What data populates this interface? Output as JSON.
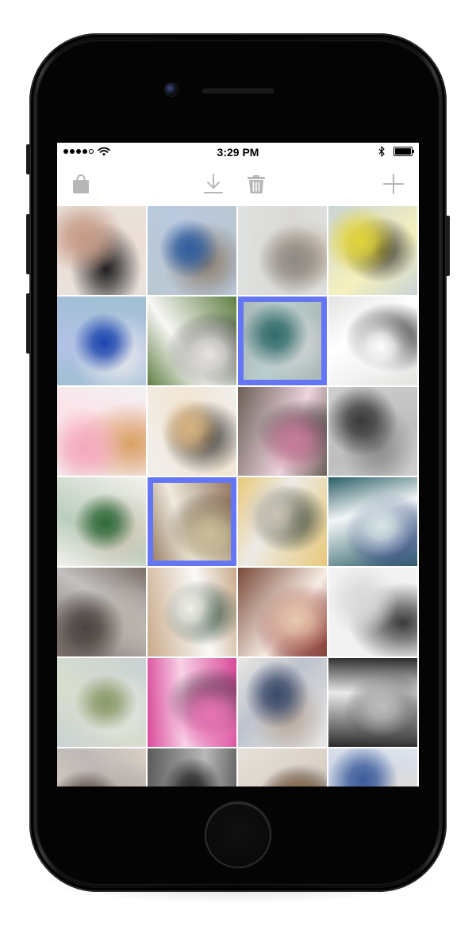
{
  "status_bar": {
    "carrier_signal": "●●●●○",
    "time": "3:29 PM",
    "bluetooth_icon": "bluetooth-icon",
    "battery_icon": "battery-icon",
    "wifi_icon": "wifi-icon"
  },
  "toolbar": {
    "left_icon": "shopping-bag-icon",
    "download_icon": "download-icon",
    "trash_icon": "trash-icon",
    "add_icon": "plus-icon",
    "icon_color": "#b7b7b7"
  },
  "accent_color": "#6476f5",
  "photos": [
    {
      "name": "photo-hands-lace",
      "colors": [
        "#e9e2db",
        "#c59a85",
        "#1d1d1d"
      ],
      "selected": false
    },
    {
      "name": "photo-three-guys-street",
      "colors": [
        "#b9c7d0",
        "#2f5e9e",
        "#8c7d6c"
      ],
      "selected": false
    },
    {
      "name": "photo-woman-curly-hair",
      "colors": [
        "#dfe2e0",
        "#8e8a83",
        "#c9b7a6"
      ],
      "selected": false
    },
    {
      "name": "photo-woman-yellow-flowers",
      "colors": [
        "#c9d4d6",
        "#e3d43a",
        "#2d2d2d"
      ],
      "selected": false
    },
    {
      "name": "photo-woman-blue-coat",
      "colors": [
        "#9fc0d3",
        "#1a45b0",
        "#e8e9ea"
      ],
      "selected": false
    },
    {
      "name": "photo-woman-striped-shirt",
      "colors": [
        "#5f7f43",
        "#e8e6e2",
        "#2c2c2c"
      ],
      "selected": false
    },
    {
      "name": "photo-man-drinking-outdoors",
      "colors": [
        "#a9b5b4",
        "#2f6a6a",
        "#d6d9d8"
      ],
      "selected": true
    },
    {
      "name": "photo-woman-kitchen",
      "colors": [
        "#e4e3e1",
        "#ffffff",
        "#2b2b2b"
      ],
      "selected": false
    },
    {
      "name": "photo-pink-ice-cream",
      "colors": [
        "#f2f2f2",
        "#f5a9bd",
        "#d9a064"
      ],
      "selected": false
    },
    {
      "name": "photo-woman-clothes-rack",
      "colors": [
        "#f1efec",
        "#d7b37f",
        "#3a3a3a"
      ],
      "selected": false
    },
    {
      "name": "photo-umbrella-street",
      "colors": [
        "#6b5f57",
        "#c97d9a",
        "#3a3a3a"
      ],
      "selected": false
    },
    {
      "name": "photo-woman-hair-bw",
      "colors": [
        "#cfcfcf",
        "#3a3a3a",
        "#8a8a8a"
      ],
      "selected": false
    },
    {
      "name": "photo-woman-plants-room",
      "colors": [
        "#f4f1ec",
        "#2f6a3a",
        "#d6c8b8"
      ],
      "selected": false
    },
    {
      "name": "photo-world-map",
      "colors": [
        "#8d6e55",
        "#cdbf9a",
        "#5d4a3a"
      ],
      "selected": true
    },
    {
      "name": "photo-woman-white-hat",
      "colors": [
        "#e8c97a",
        "#c9c3b7",
        "#2f3b2a"
      ],
      "selected": false
    },
    {
      "name": "photo-woman-neon-shop",
      "colors": [
        "#2a5d66",
        "#d9e6e6",
        "#3a4a8a"
      ],
      "selected": false
    },
    {
      "name": "photo-people-crossing-street",
      "colors": [
        "#7a6e66",
        "#4a4340",
        "#b8b0a8"
      ],
      "selected": false
    },
    {
      "name": "photo-jersey-back",
      "colors": [
        "#c9aa8a",
        "#f1efe9",
        "#2c4a3a"
      ],
      "selected": false
    },
    {
      "name": "photo-couple-hug",
      "colors": [
        "#7a4a3a",
        "#e8c9b0",
        "#8a2a2a"
      ],
      "selected": false
    },
    {
      "name": "photo-woman-window-light",
      "colors": [
        "#f2f2f2",
        "#d9d9d9",
        "#3a3a3a"
      ],
      "selected": false
    },
    {
      "name": "photo-hallway-chairs",
      "colors": [
        "#c9d2d4",
        "#8a9a6a",
        "#e8e8e6"
      ],
      "selected": false
    },
    {
      "name": "photo-pink-flower-field",
      "colors": [
        "#d94a9a",
        "#e874b4",
        "#3a2a3a"
      ],
      "selected": false
    },
    {
      "name": "photo-woman-reading-magazine",
      "colors": [
        "#e9e7e4",
        "#3a4a6a",
        "#b8a89a"
      ],
      "selected": false
    },
    {
      "name": "photo-bw-silhouettes",
      "colors": [
        "#2a2a2a",
        "#bfbfbf",
        "#4a4a4a"
      ],
      "selected": false
    },
    {
      "name": "photo-curly-hair-portrait",
      "colors": [
        "#d9d0c6",
        "#3a2a22",
        "#b8b0a8"
      ],
      "selected": false
    },
    {
      "name": "photo-city-buildings",
      "colors": [
        "#5a5a5a",
        "#2a2a2a",
        "#8a8a8a"
      ],
      "selected": false
    },
    {
      "name": "photo-man-reading-window",
      "colors": [
        "#e6e1da",
        "#8a6a4a",
        "#3a3a3a"
      ],
      "selected": false
    },
    {
      "name": "photo-woman-scarf-sky",
      "colors": [
        "#dfe6ee",
        "#3a5a9a",
        "#e9e2d6"
      ],
      "selected": false
    }
  ]
}
